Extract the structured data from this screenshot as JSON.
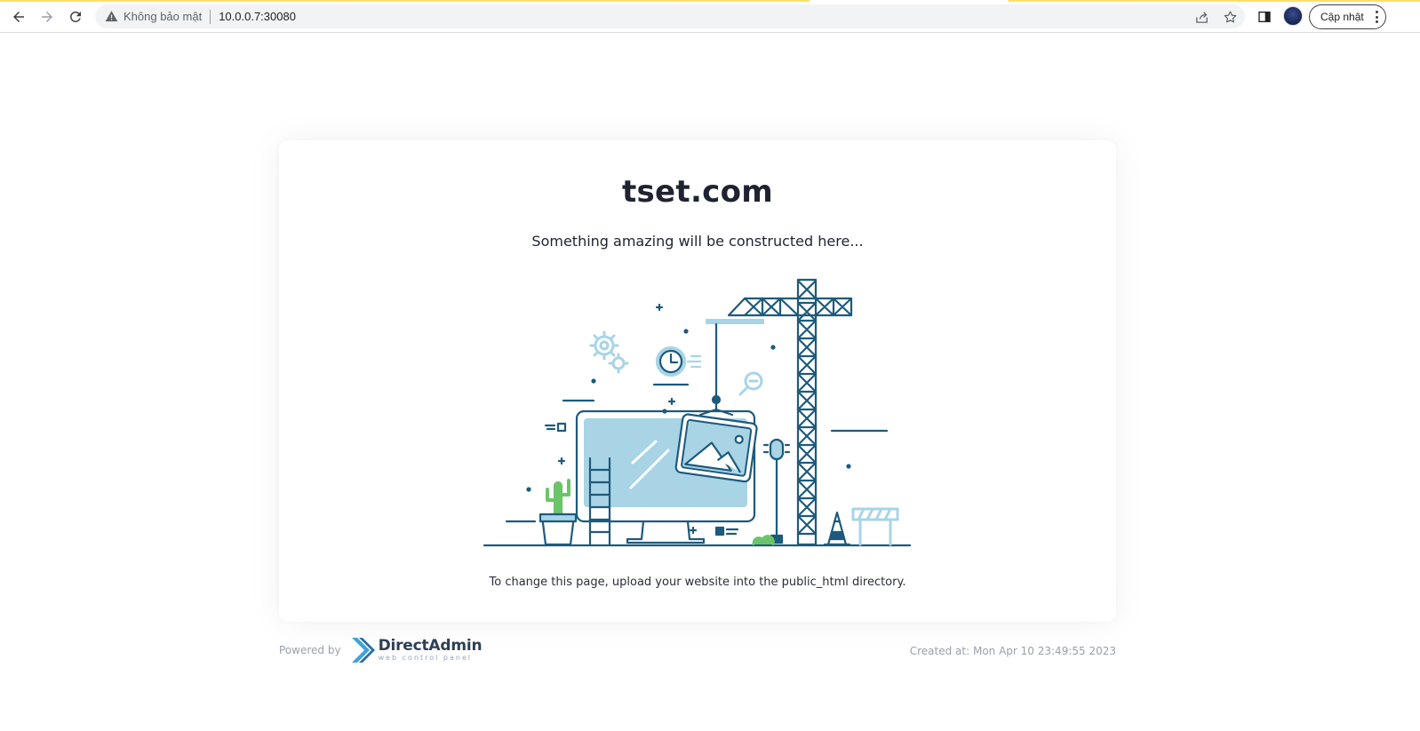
{
  "browser": {
    "security_label": "Không bảo mật",
    "url": "10.0.0.7:30080",
    "update_label": "Cập nhật"
  },
  "page": {
    "site_title": "tset.com",
    "subtitle": "Something amazing will be constructed here...",
    "hint": "To change this page, upload your website into the public_html directory."
  },
  "footer": {
    "powered_by": "Powered by",
    "brand_name": "DirectAdmin",
    "brand_tagline": "web control panel",
    "created_at": "Created at: Mon Apr 10 23:49:55 2023"
  },
  "colors": {
    "accent_dark": "#1d5a7c",
    "accent_light": "#a8d4e6",
    "cactus": "#6cc46a"
  }
}
